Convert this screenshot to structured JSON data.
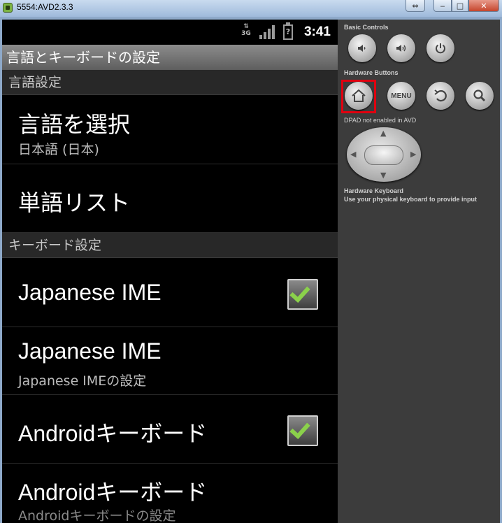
{
  "window": {
    "title": "5554:AVD2.3.3",
    "buttons": {
      "swap": "⇔",
      "minimize": "‒",
      "maximize": "□",
      "close": "✕"
    }
  },
  "statusbar": {
    "network": "3G",
    "battery": "?",
    "time": "3:41"
  },
  "app": {
    "title": "言語とキーボードの設定",
    "sections": [
      {
        "header": "言語設定",
        "items": [
          {
            "title": "言語を選択",
            "summary": "日本語 (日本)"
          },
          {
            "title": "単語リスト"
          }
        ]
      },
      {
        "header": "キーボード設定",
        "items": [
          {
            "title": "Japanese IME",
            "checked": true
          },
          {
            "title": "Japanese IME",
            "summary": "Japanese IMEの設定"
          },
          {
            "title": "Androidキーボード",
            "checked": true
          },
          {
            "title": "Androidキーボード",
            "summary": "Androidキーボードの設定"
          }
        ]
      }
    ]
  },
  "controls": {
    "basic_label": "Basic Controls",
    "hardware_label": "Hardware Buttons",
    "menu_label": "MENU",
    "dpad_label": "DPAD not enabled in AVD",
    "keyboard_label": "Hardware Keyboard",
    "keyboard_note": "Use your physical keyboard to provide input",
    "icons": [
      "volume-down-icon",
      "volume-up-icon",
      "power-icon",
      "home-icon",
      "menu-button",
      "back-icon",
      "search-icon"
    ],
    "highlight_color": "#e0000f"
  }
}
